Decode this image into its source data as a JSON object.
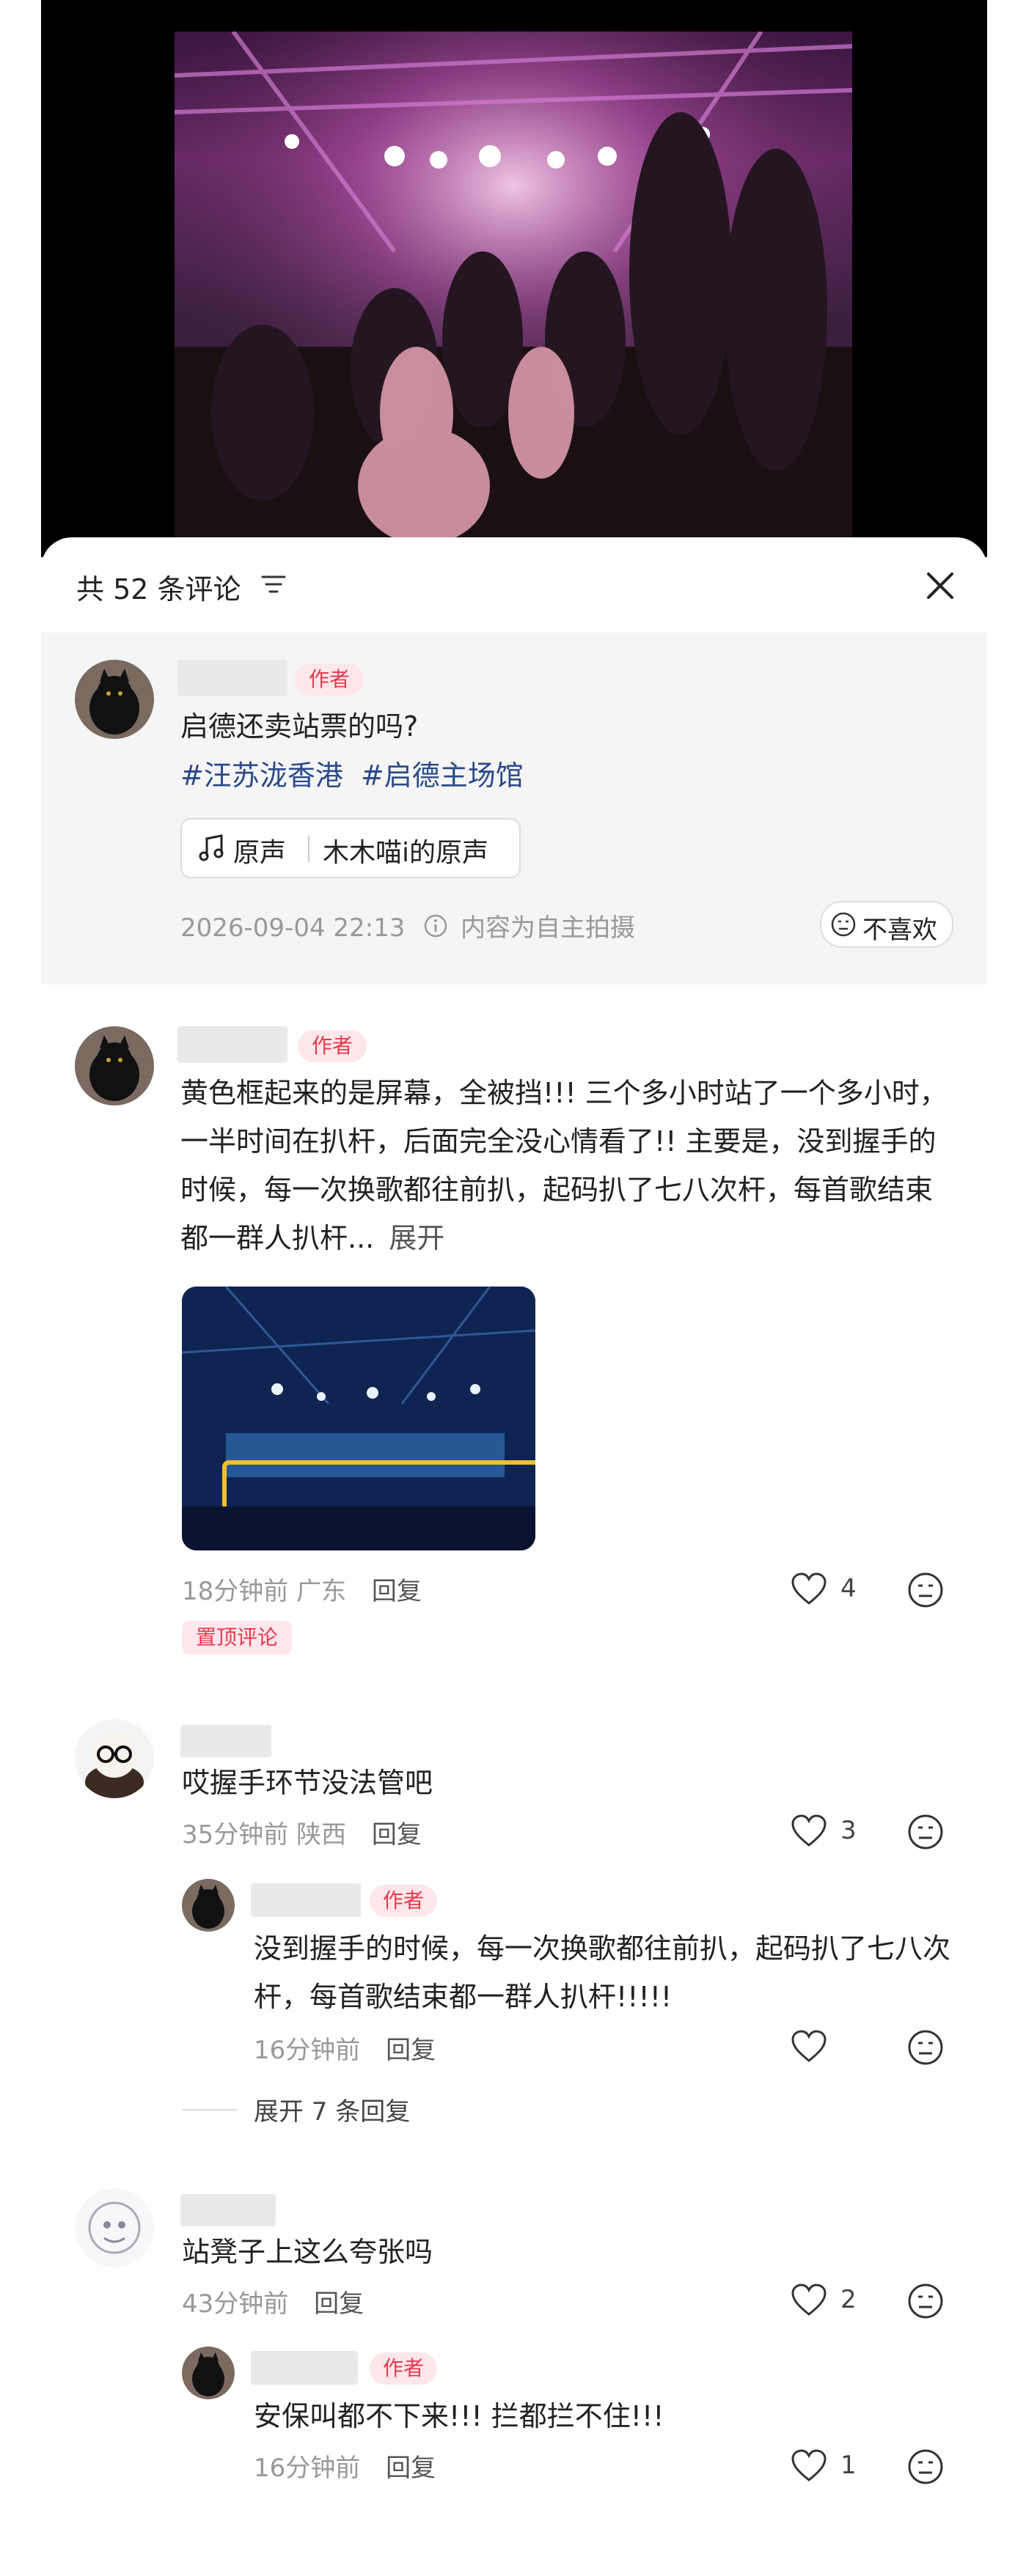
{
  "header": {
    "title": "共 52 条评论"
  },
  "post": {
    "author_tag": "作者",
    "text": "启德还卖站票的吗?",
    "hashtags": [
      "#汪苏泷香港",
      "#启德主场馆"
    ],
    "sound_label": "原声",
    "sound_name": "木木喵i的原声",
    "timestamp": "2026-09-04 22:13",
    "notice": "内容为自主拍摄",
    "dislike_label": "不喜欢"
  },
  "comments": [
    {
      "author_tag": "作者",
      "text": "黄色框起来的是屏幕，全被挡!!! 三个多小时站了一个多小时，一半时间在扒杆，后面完全没心情看了!! 主要是，没到握手的时候，每一次换歌都往前扒，起码扒了七八次杆，每首歌结束都一群人扒杆...",
      "expand": "展开",
      "meta": "18分钟前 广东",
      "reply": "回复",
      "likes": "4",
      "pinned": "置顶评论"
    },
    {
      "text": "哎握手环节没法管吧",
      "meta": "35分钟前 陕西",
      "reply": "回复",
      "likes": "3",
      "sub": {
        "author_tag": "作者",
        "text": "没到握手的时候，每一次换歌都往前扒，起码扒了七八次杆，每首歌结束都一群人扒杆!!!!!",
        "meta": "16分钟前",
        "reply": "回复"
      },
      "more_replies": "展开 7 条回复"
    },
    {
      "text": "站凳子上这么夸张吗",
      "meta": "43分钟前",
      "reply": "回复",
      "likes": "2",
      "sub": {
        "author_tag": "作者",
        "text": "安保叫都不下来!!! 拦都拦不住!!!",
        "meta": "16分钟前",
        "reply": "回复",
        "likes": "1"
      }
    }
  ]
}
